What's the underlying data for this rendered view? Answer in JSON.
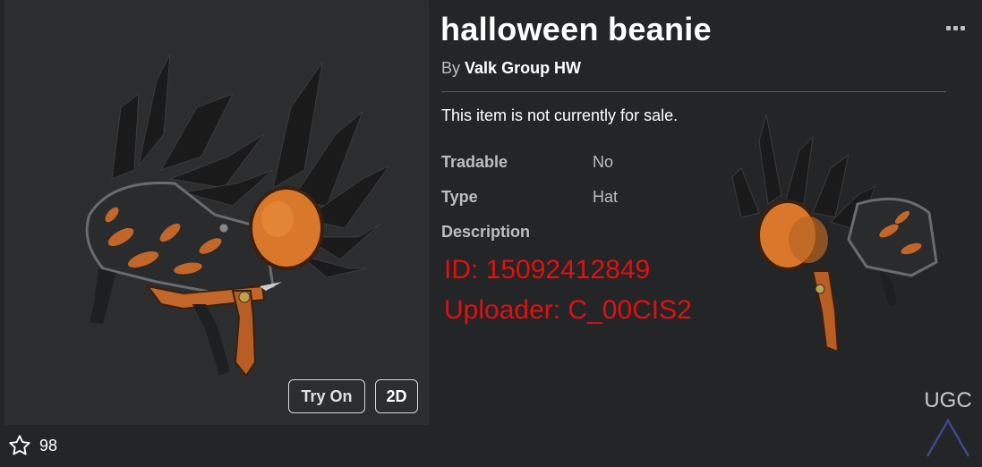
{
  "item": {
    "title": "halloween beanie",
    "by_prefix": "By",
    "creator": "Valk Group HW",
    "sale_status": "This item is not currently for sale."
  },
  "details": {
    "tradable_label": "Tradable",
    "tradable_value": "No",
    "type_label": "Type",
    "type_value": "Hat",
    "description_label": "Description"
  },
  "description_lines": [
    "ID: 15092412849",
    "Uploader: C_00CIS2"
  ],
  "thumbnail": {
    "try_on_label": "Try On",
    "view_2d_label": "2D"
  },
  "favorites": {
    "count": "98",
    "icon": "star-outline-icon"
  },
  "menu_icon": "more-options-icon",
  "watermark": "UGC",
  "colors": {
    "background": "#232527",
    "panel": "#2b2d2f",
    "description_text": "#e01010",
    "muted_text": "#bdbebe",
    "accent_orange": "#d9782a"
  }
}
